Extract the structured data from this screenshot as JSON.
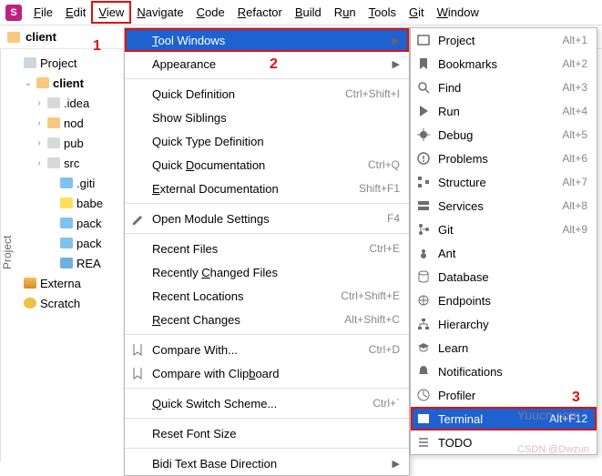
{
  "menubar": [
    "File",
    "Edit",
    "View",
    "Navigate",
    "Code",
    "Refactor",
    "Build",
    "Run",
    "Tools",
    "Git",
    "Window"
  ],
  "menubar_ul": [
    "F",
    "E",
    "V",
    "N",
    "C",
    "R",
    "B",
    "u",
    "T",
    "G",
    "W"
  ],
  "menubar_boxed_index": 2,
  "crumb": {
    "name": "client"
  },
  "gutter": "Project",
  "sidebar": {
    "project_label": "Project",
    "root": "client",
    "items": [
      {
        "label": ".idea",
        "ic": "fld",
        "tw": "›",
        "indent": 1
      },
      {
        "label": "nod",
        "ic": "fldsel",
        "tw": "›",
        "indent": 1
      },
      {
        "label": "pub",
        "ic": "fld",
        "tw": "›",
        "indent": 1
      },
      {
        "label": "src",
        "ic": "fld",
        "tw": "›",
        "indent": 1
      },
      {
        "label": ".giti",
        "ic": "json",
        "tw": "",
        "indent": 2
      },
      {
        "label": "babe",
        "ic": "js",
        "tw": "",
        "indent": 2
      },
      {
        "label": "pack",
        "ic": "json",
        "tw": "",
        "indent": 2
      },
      {
        "label": "pack",
        "ic": "json",
        "tw": "",
        "indent": 2
      },
      {
        "label": "REA",
        "ic": "md",
        "tw": "",
        "indent": 2
      }
    ],
    "extern": "Externa",
    "scratch": "Scratch"
  },
  "view_menu": [
    {
      "label": "Tool Windows",
      "ul": "T",
      "arrow": true,
      "hl": true,
      "boxed": true
    },
    {
      "label": "Appearance",
      "ul": "",
      "arrow": true
    },
    {
      "sep": true
    },
    {
      "label": "Quick Definition",
      "ul": "",
      "shortcut": "Ctrl+Shift+I"
    },
    {
      "label": "Show Siblings",
      "ul": ""
    },
    {
      "label": "Quick Type Definition",
      "ul": ""
    },
    {
      "label": "Quick Documentation",
      "ul": "D",
      "shortcut": "Ctrl+Q"
    },
    {
      "label": "External Documentation",
      "ul": "E",
      "shortcut": "Shift+F1"
    },
    {
      "sep": true
    },
    {
      "label": "Open Module Settings",
      "ul": "",
      "icon": "pencil",
      "shortcut": "F4"
    },
    {
      "sep": true
    },
    {
      "label": "Recent Files",
      "ul": "",
      "shortcut": "Ctrl+E"
    },
    {
      "label": "Recently Changed Files",
      "ul": "C"
    },
    {
      "label": "Recent Locations",
      "ul": "",
      "shortcut": "Ctrl+Shift+E"
    },
    {
      "label": "Recent Changes",
      "ul": "R",
      "shortcut": "Alt+Shift+C"
    },
    {
      "sep": true
    },
    {
      "label": "Compare With...",
      "ul": "",
      "icon": "diff",
      "shortcut": "Ctrl+D"
    },
    {
      "label": "Compare with Clipboard",
      "ul": "b",
      "icon": "diff"
    },
    {
      "sep": true
    },
    {
      "label": "Quick Switch Scheme...",
      "ul": "Q",
      "shortcut": "Ctrl+`"
    },
    {
      "sep": true
    },
    {
      "label": "Reset Font Size",
      "ul": ""
    },
    {
      "sep": true
    },
    {
      "label": "Bidi Text Base Direction",
      "ul": "",
      "arrow": true
    }
  ],
  "tool_windows_menu": [
    {
      "label": "Project",
      "icon": "project",
      "shortcut": "Alt+1"
    },
    {
      "label": "Bookmarks",
      "icon": "bookmark",
      "shortcut": "Alt+2"
    },
    {
      "label": "Find",
      "icon": "find",
      "shortcut": "Alt+3"
    },
    {
      "label": "Run",
      "icon": "run",
      "shortcut": "Alt+4"
    },
    {
      "label": "Debug",
      "icon": "debug",
      "shortcut": "Alt+5"
    },
    {
      "label": "Problems",
      "icon": "problems",
      "shortcut": "Alt+6"
    },
    {
      "label": "Structure",
      "icon": "structure",
      "shortcut": "Alt+7"
    },
    {
      "label": "Services",
      "icon": "services",
      "shortcut": "Alt+8"
    },
    {
      "label": "Git",
      "icon": "git",
      "shortcut": "Alt+9"
    },
    {
      "label": "Ant",
      "icon": "ant"
    },
    {
      "label": "Database",
      "icon": "database"
    },
    {
      "label": "Endpoints",
      "icon": "endpoints"
    },
    {
      "label": "Hierarchy",
      "icon": "hierarchy"
    },
    {
      "label": "Learn",
      "icon": "learn"
    },
    {
      "label": "Notifications",
      "icon": "notify"
    },
    {
      "label": "Profiler",
      "icon": "profiler"
    },
    {
      "label": "Terminal",
      "icon": "terminal",
      "shortcut": "Alt+F12",
      "hl": true,
      "boxed": true
    },
    {
      "label": "TODO",
      "icon": "todo"
    }
  ],
  "annotations": {
    "a1": "1",
    "a2": "2",
    "a3": "3"
  },
  "watermark": {
    "t1": "Yuucn.com",
    "t2": "CSDN @Dwzun"
  }
}
